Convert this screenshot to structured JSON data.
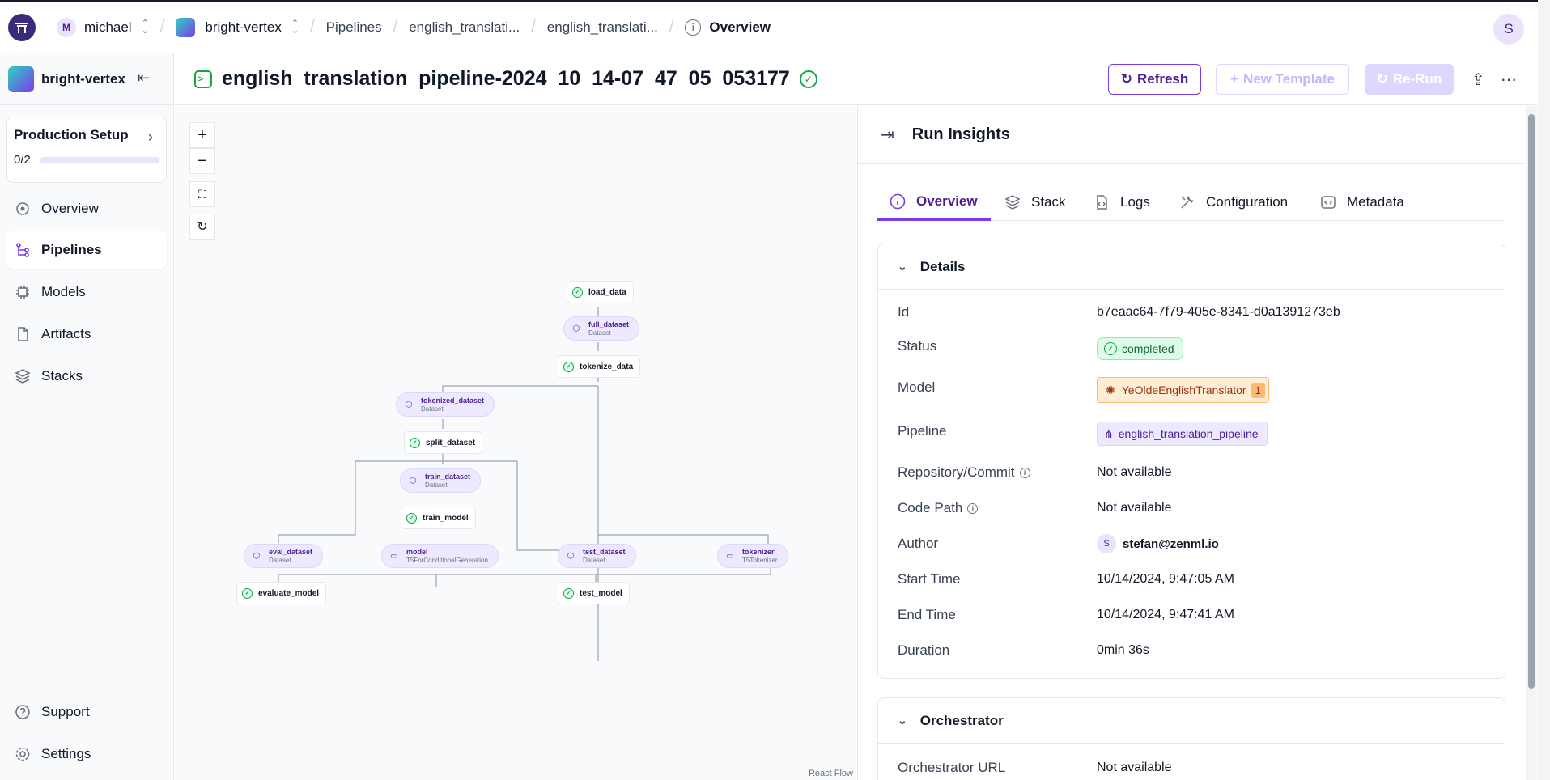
{
  "topbar": {
    "user_initial": "M",
    "user_name": "michael",
    "workspace": "bright-vertex",
    "crumbs": [
      "Pipelines",
      "english_translati...",
      "english_translati...",
      "Overview"
    ],
    "avatar": "S"
  },
  "sidebar": {
    "workspace": "bright-vertex",
    "setup": {
      "title": "Production Setup",
      "progress_label": "0/2",
      "progress_fraction": 0.0
    },
    "items": [
      {
        "label": "Overview",
        "icon": "overview-icon"
      },
      {
        "label": "Pipelines",
        "icon": "pipelines-icon"
      },
      {
        "label": "Models",
        "icon": "models-icon"
      },
      {
        "label": "Artifacts",
        "icon": "artifacts-icon"
      },
      {
        "label": "Stacks",
        "icon": "stacks-icon"
      }
    ],
    "footer": [
      {
        "label": "Support",
        "icon": "help-icon"
      },
      {
        "label": "Settings",
        "icon": "settings-icon"
      }
    ]
  },
  "header": {
    "title": "english_translation_pipeline-2024_10_14-07_47_05_053177",
    "refresh": "Refresh",
    "new_template": "New Template",
    "rerun": "Re-Run"
  },
  "dag": {
    "steps": [
      "load_data",
      "tokenize_data",
      "split_dataset",
      "train_model",
      "evaluate_model",
      "test_model"
    ],
    "artifacts": [
      {
        "name": "full_dataset",
        "type": "Dataset"
      },
      {
        "name": "tokenized_dataset",
        "type": "Dataset"
      },
      {
        "name": "train_dataset",
        "type": "Dataset"
      },
      {
        "name": "eval_dataset",
        "type": "Dataset"
      },
      {
        "name": "model",
        "type": "T5ForConditionalGeneration"
      },
      {
        "name": "test_dataset",
        "type": "Dataset"
      },
      {
        "name": "tokenizer",
        "type": "T5Tokenizer"
      }
    ],
    "react_flow": "React Flow"
  },
  "panel": {
    "title": "Run Insights",
    "tabs": [
      "Overview",
      "Stack",
      "Logs",
      "Configuration",
      "Metadata"
    ],
    "details": {
      "heading": "Details",
      "id_label": "Id",
      "id": "b7eaac64-7f79-405e-8341-d0a1391273eb",
      "status_label": "Status",
      "status": "completed",
      "model_label": "Model",
      "model": "YeOldeEnglishTranslator",
      "model_version": "1",
      "pipeline_label": "Pipeline",
      "pipeline": "english_translation_pipeline",
      "repo_label": "Repository/Commit",
      "repo": "Not available",
      "code_label": "Code Path",
      "code": "Not available",
      "author_label": "Author",
      "author_initial": "S",
      "author": "stefan@zenml.io",
      "start_label": "Start Time",
      "start": "10/14/2024, 9:47:05 AM",
      "end_label": "End Time",
      "end": "10/14/2024, 9:47:41 AM",
      "duration_label": "Duration",
      "duration": "0min 36s"
    },
    "orchestrator": {
      "heading": "Orchestrator",
      "url_label": "Orchestrator URL",
      "url": "Not available"
    }
  },
  "colors": {
    "accent": "#7c3aed",
    "success": "#16a34a",
    "model": "#fdba74"
  }
}
